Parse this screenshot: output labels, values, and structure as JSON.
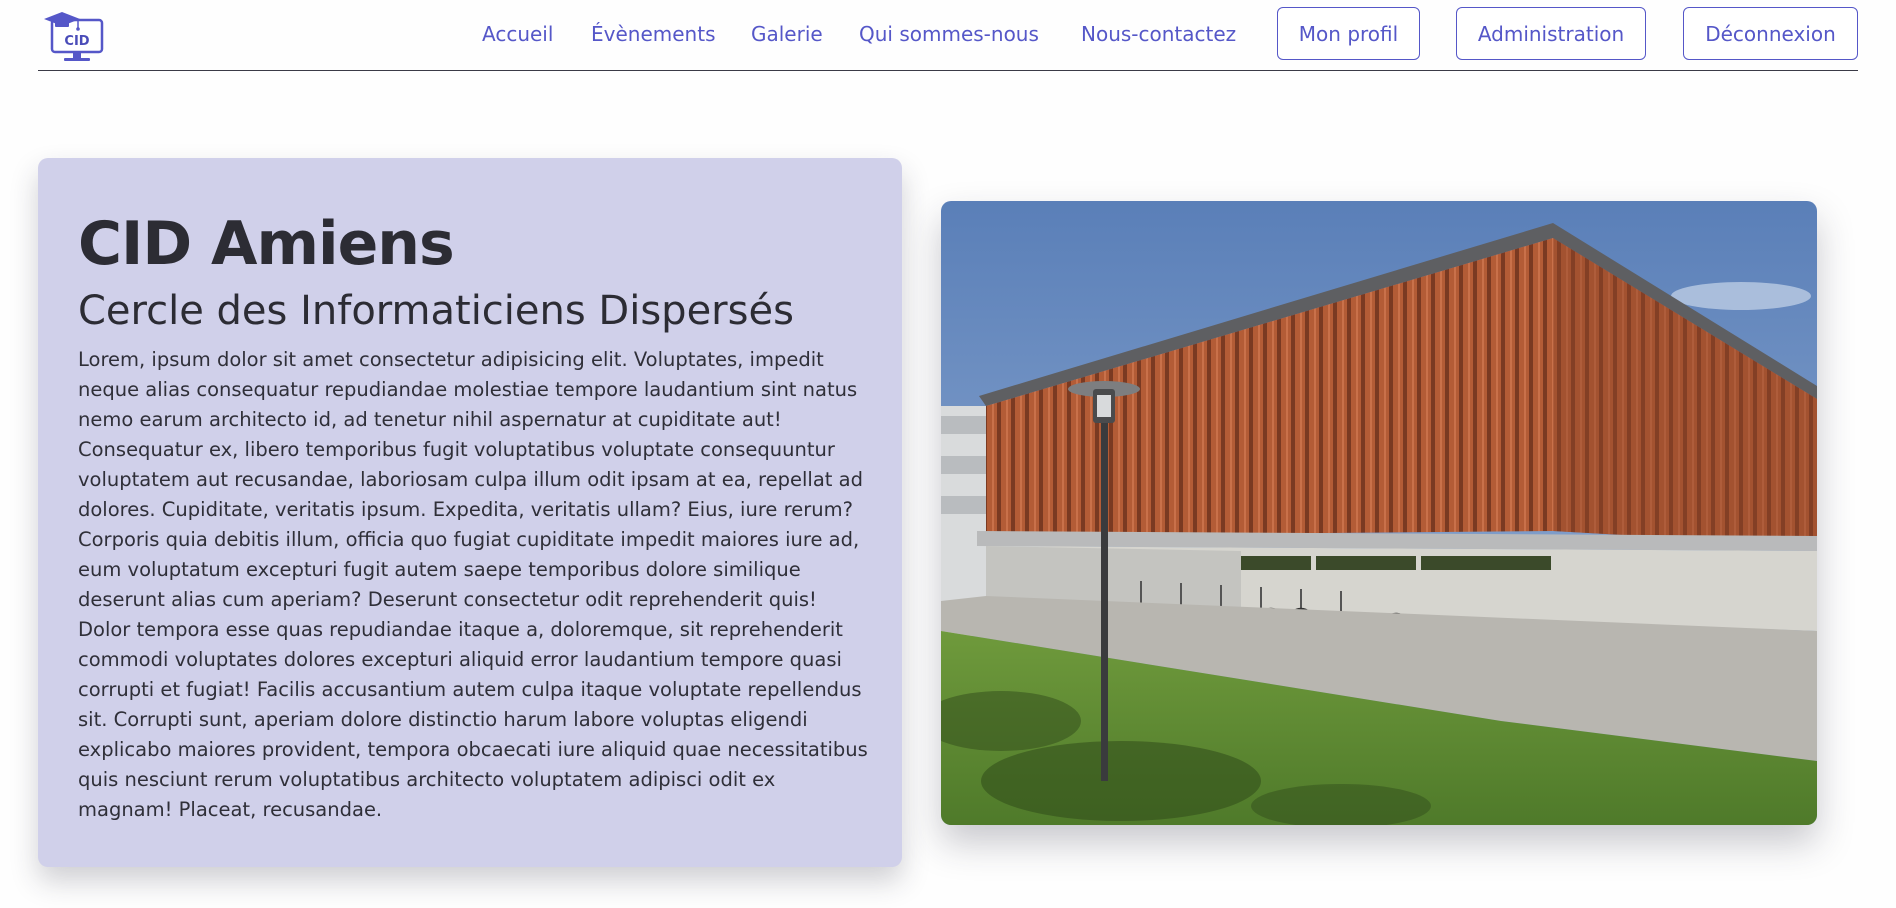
{
  "header": {
    "logo": {
      "text": "CID",
      "icon": "graduation-cap-monitor-icon"
    },
    "nav_links": [
      "Accueil",
      "Évènements",
      "Galerie",
      "Qui sommes-nous",
      "Nous-contactez"
    ],
    "nav_buttons": [
      "Mon profil",
      "Administration",
      "Déconnexion"
    ]
  },
  "hero": {
    "title": "CID Amiens",
    "subtitle": "Cercle des Informaticiens Dispersés",
    "body": "Lorem, ipsum dolor sit amet consectetur adipisicing elit. Voluptates, impedit neque alias consequatur repudiandae molestiae tempore laudantium sint natus nemo earum architecto id, ad tenetur nihil aspernatur at cupiditate aut! Consequatur ex, libero temporibus fugit voluptatibus voluptate consequuntur voluptatem aut recusandae, laboriosam culpa illum odit ipsam at ea, repellat ad dolores. Cupiditate, veritatis ipsum. Expedita, veritatis ullam? Eius, iure rerum? Corporis quia debitis illum, officia quo fugiat cupiditate impedit maiores iure ad, eum voluptatum excepturi fugit autem saepe temporibus dolore similique deserunt alias cum aperiam? Deserunt consectetur odit reprehenderit quis! Dolor tempora esse quas repudiandae itaque a, doloremque, sit reprehenderit commodi voluptates dolores excepturi aliquid error laudantium tempore quasi corrupti et fugiat! Facilis accusantium autem culpa itaque voluptate repellendus sit. Corrupti sunt, aperiam dolore distinctio harum labore voluptas eligendi explicabo maiores provident, tempora obcaecati iure aliquid quae necessitatibus quis nesciunt rerum voluptatibus architecto voluptatem adipisci odit ex magnam! Placeat, recusandae."
  },
  "colors": {
    "accent": "#5557c8",
    "card_background": "#d0d0ea",
    "text": "#2c2c34"
  }
}
